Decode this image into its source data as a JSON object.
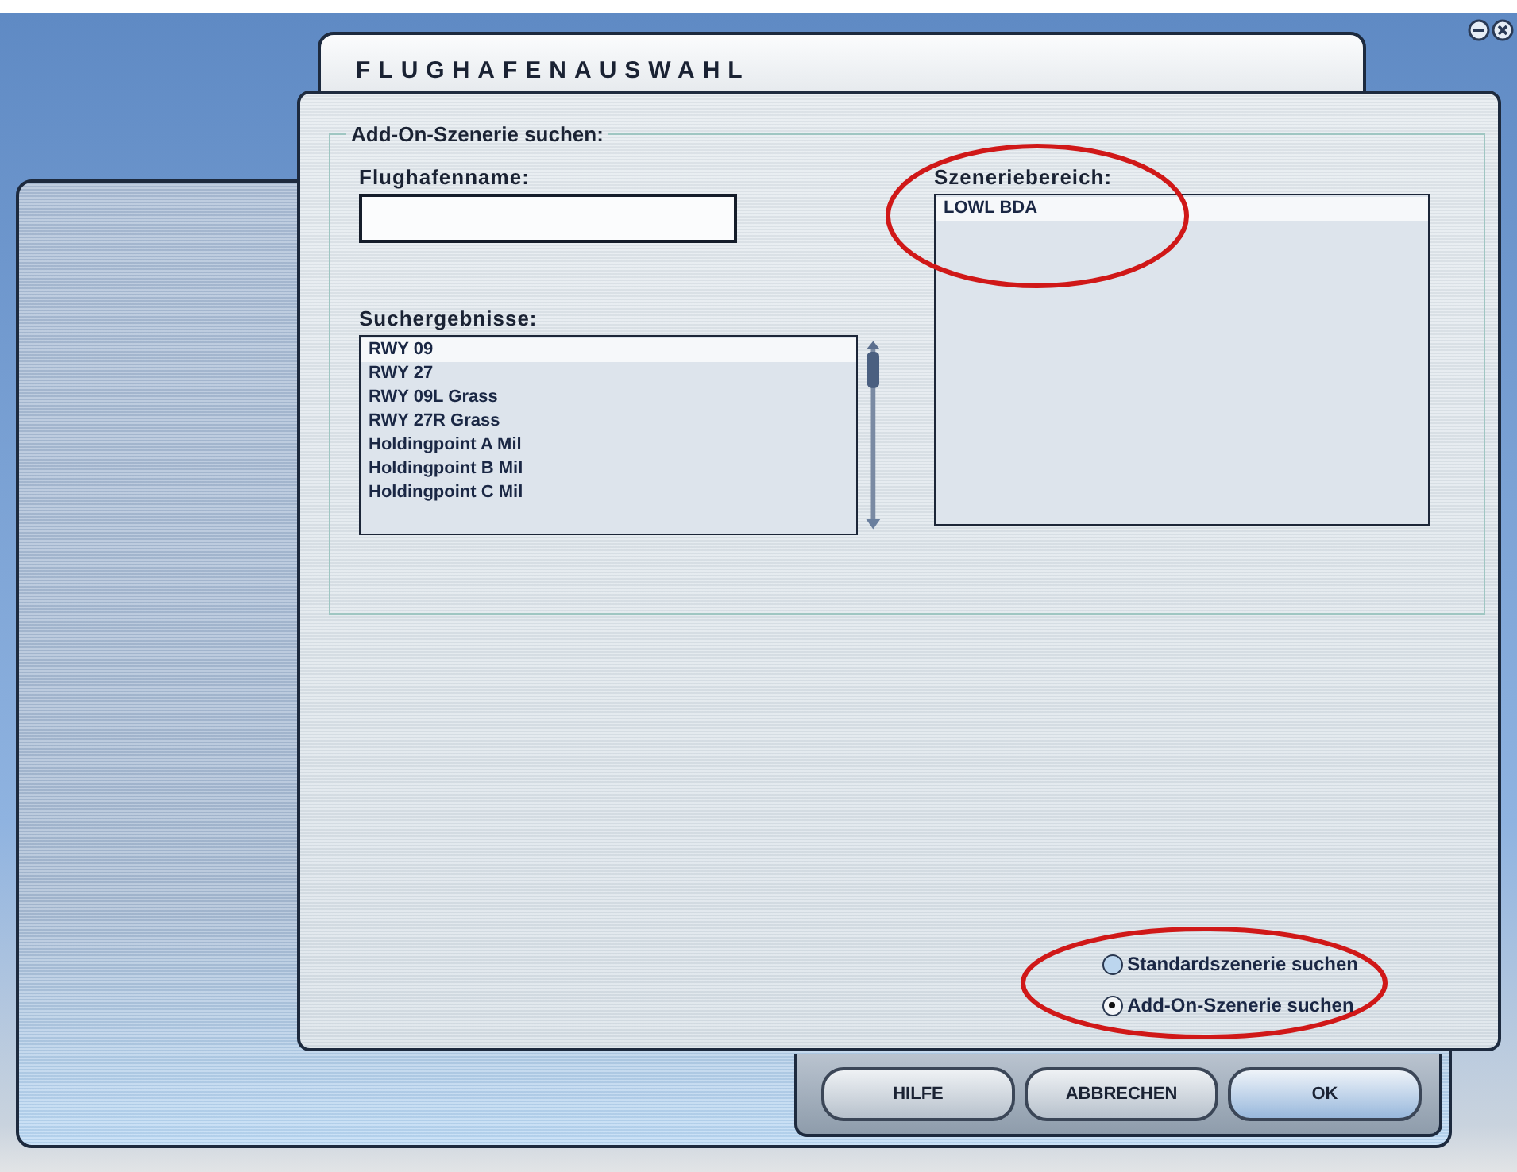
{
  "window": {
    "title": "FLUGHAFENAUSWAHL"
  },
  "search_group": {
    "title": "Add-On-Szenerie suchen:",
    "airport_name": {
      "label": "Flughafenname:"
    },
    "results": {
      "label": "Suchergebnisse:",
      "items": [
        {
          "text": "RWY 09",
          "selected": true
        },
        {
          "text": "RWY 27",
          "selected": false
        },
        {
          "text": "RWY 09L Grass",
          "selected": false
        },
        {
          "text": "RWY 27R Grass",
          "selected": false
        },
        {
          "text": "Holdingpoint A Mil",
          "selected": false
        },
        {
          "text": "Holdingpoint B Mil",
          "selected": false
        },
        {
          "text": "Holdingpoint C Mil",
          "selected": false
        }
      ]
    },
    "scenery_area": {
      "label": "Szeneriebereich:",
      "items": [
        {
          "text": "LOWL BDA",
          "selected": true
        }
      ]
    }
  },
  "scenery_source": [
    {
      "label": "Standardszenerie suchen",
      "selected": false
    },
    {
      "label": "Add-On-Szenerie suchen",
      "selected": true
    }
  ],
  "buttons": [
    {
      "label": "HILFE",
      "kind": "normal"
    },
    {
      "label": "ABBRECHEN",
      "kind": "normal"
    },
    {
      "label": "OK",
      "kind": "default"
    }
  ]
}
